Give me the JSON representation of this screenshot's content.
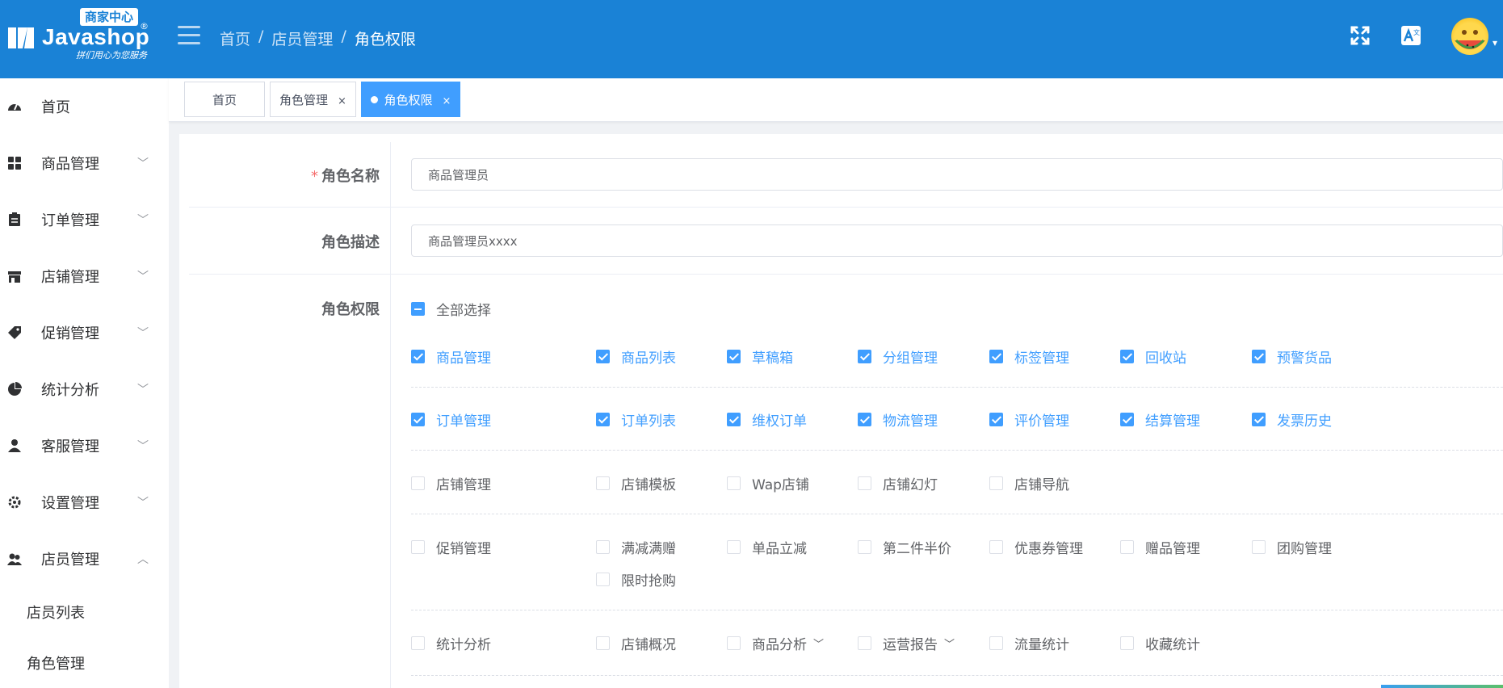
{
  "header": {
    "logo_badge": "商家中心",
    "logo_text": "Javashop",
    "logo_reg": "®",
    "logo_slogan": "拼们用心为您服务",
    "breadcrumb": [
      "首页",
      "店员管理",
      "角色权限"
    ],
    "breadcrumb_sep": "/"
  },
  "sidebar": {
    "items": [
      {
        "label": "首页"
      },
      {
        "label": "商品管理"
      },
      {
        "label": "订单管理"
      },
      {
        "label": "店铺管理"
      },
      {
        "label": "促销管理"
      },
      {
        "label": "统计分析"
      },
      {
        "label": "客服管理"
      },
      {
        "label": "设置管理"
      },
      {
        "label": "店员管理"
      }
    ],
    "sub_items": [
      {
        "label": "店员列表"
      },
      {
        "label": "角色管理"
      }
    ]
  },
  "tabs": [
    {
      "label": "首页"
    },
    {
      "label": "角色管理",
      "close": "×"
    },
    {
      "label": "角色权限",
      "close": "×"
    }
  ],
  "form": {
    "name_label": "角色名称",
    "required_mark": "*",
    "name_value": "商品管理员",
    "desc_label": "角色描述",
    "desc_value": "商品管理员xxxx",
    "perm_label": "角色权限",
    "select_all": "全部选择"
  },
  "permissions": {
    "goods": [
      "商品管理",
      "商品列表",
      "草稿箱",
      "分组管理",
      "标签管理",
      "回收站",
      "预警货品"
    ],
    "order": [
      "订单管理",
      "订单列表",
      "维权订单",
      "物流管理",
      "评价管理",
      "结算管理",
      "发票历史"
    ],
    "shop": [
      "店铺管理",
      "店铺模板",
      "Wap店铺",
      "店铺幻灯",
      "店铺导航"
    ],
    "promo": [
      "促销管理",
      "满减满赠",
      "单品立减",
      "第二件半价",
      "优惠券管理",
      "赠品管理",
      "团购管理",
      "限时抢购"
    ],
    "stats": [
      "统计分析",
      "店铺概况",
      "商品分析",
      "运营报告",
      "流量统计",
      "收藏统计"
    ]
  },
  "colors": {
    "header_bg": "#1a82d6",
    "accent": "#409eff"
  }
}
